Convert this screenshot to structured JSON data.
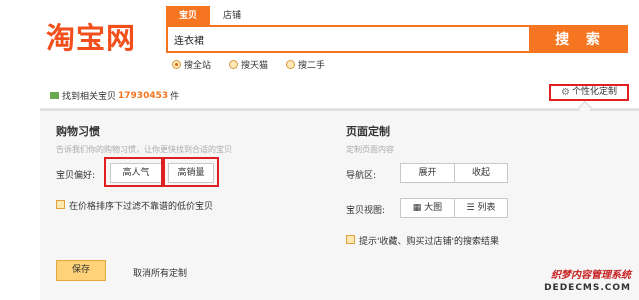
{
  "header": {
    "logo": "淘宝网",
    "tabs": [
      "宝贝",
      "店铺"
    ],
    "search_value": "连衣裙",
    "search_button": "搜 索",
    "scopes": [
      {
        "label": "搜全站",
        "checked": true
      },
      {
        "label": "搜天猫",
        "checked": false
      },
      {
        "label": "搜二手",
        "checked": false
      }
    ]
  },
  "result": {
    "prefix": "找到相关宝贝",
    "count": "17930453",
    "suffix": "件"
  },
  "custom_button": "个性化定制",
  "panel": {
    "shopping": {
      "title": "购物习惯",
      "desc": "告诉我们你的购物习惯，让你更快找到合适的宝贝",
      "pref_label": "宝贝偏好:",
      "pref_buttons": [
        "高人气",
        "高销量"
      ],
      "filter_label": "在价格排序下过滤不靠谱的低价宝贝"
    },
    "page": {
      "title": "页面定制",
      "desc": "定制页面内容",
      "nav_label": "导航区:",
      "nav_buttons": [
        "展开",
        "收起"
      ],
      "view_label": "宝贝视图:",
      "view_buttons": [
        "大图",
        "列表"
      ],
      "tip_label": "提示'收藏、购买过店铺'的搜索结果"
    },
    "save": "保存",
    "cancel": "取消所有定制"
  },
  "watermark": {
    "line1": "织梦内容管理系统",
    "line2": "DEDECMS.COM"
  }
}
